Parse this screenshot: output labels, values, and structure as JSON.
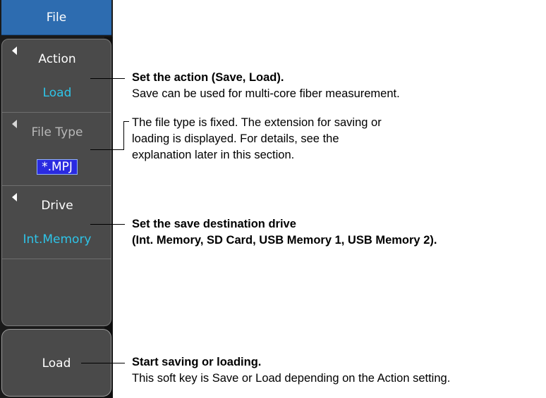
{
  "panel": {
    "title": "File",
    "softkeys": [
      {
        "label": "Action",
        "value": "Load"
      },
      {
        "label": "File Type",
        "value": "*.MPJ"
      },
      {
        "label": "Drive",
        "value": "Int.Memory"
      }
    ],
    "execute_label": "Load"
  },
  "callouts": {
    "action": {
      "title": "Set the action (Save, Load).",
      "line1": "Save can be used for multi-core fiber measurement."
    },
    "file_type": {
      "line1": "The file type is fixed. The extension for saving or",
      "line2": "loading is displayed. For details, see the",
      "line3": "explanation later in this section."
    },
    "drive": {
      "line1": "Set the save destination drive",
      "line2": "(Int. Memory, SD Card, USB Memory 1, USB Memory 2)."
    },
    "load": {
      "title": "Start saving or loading.",
      "line1": "This soft key is Save or Load depending on the Action setting."
    }
  },
  "colors": {
    "header_bg": "#2d6cb0",
    "value_text": "#2ec4e8",
    "panel_bg": "#4a4a4a"
  }
}
